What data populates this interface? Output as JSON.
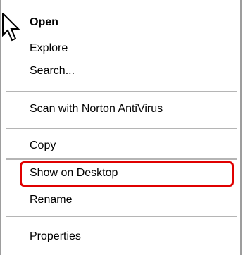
{
  "context_menu": {
    "items": [
      {
        "label": "Open",
        "bold": true
      },
      {
        "label": "Explore",
        "bold": false
      },
      {
        "label": "Search...",
        "bold": false
      },
      {
        "label": "Scan with Norton AntiVirus",
        "bold": false
      },
      {
        "label": "Copy",
        "bold": false
      },
      {
        "label": "Show on Desktop",
        "bold": false,
        "highlighted": true
      },
      {
        "label": "Rename",
        "bold": false
      },
      {
        "label": "Properties",
        "bold": false
      }
    ]
  },
  "cursor": {
    "icon": "arrow-pointer-icon"
  },
  "colors": {
    "highlight_border": "#e00000",
    "menu_border": "#9d9d9d",
    "separator": "#b5b5b5"
  }
}
